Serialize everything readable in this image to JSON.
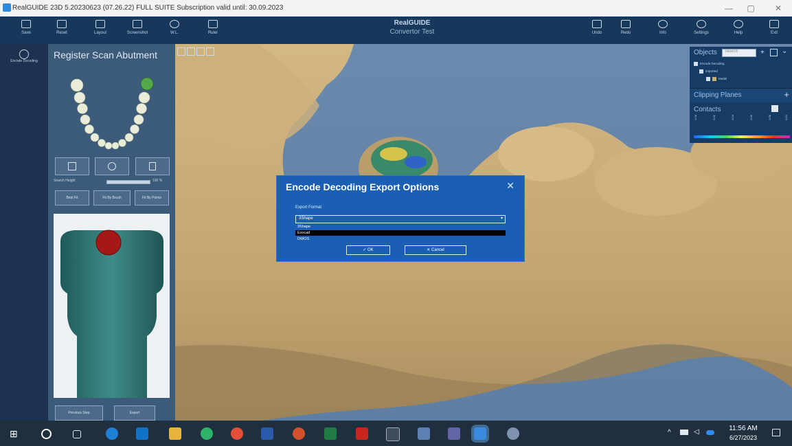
{
  "window": {
    "title": "RealGUIDE 23D 5.20230623 (07.26.22) FULL SUITE Subscription valid until: 30.09.2023"
  },
  "toolbar": {
    "left": [
      "Save",
      "Reset",
      "Layout",
      "Screenshot",
      "W.L.",
      "Ruler"
    ],
    "right": [
      "Undo",
      "Redo",
      "Info",
      "Settings",
      "Help",
      "Exit"
    ],
    "brand_logo": "RealGUIDE",
    "brand_sub": "Convertor Test"
  },
  "rail": {
    "label": "Encode Decoding"
  },
  "panel": {
    "title": "Register Scan Abutment",
    "search_height_label": "Search Height",
    "search_height_value": "100 %",
    "search_height_percent": 100,
    "fit_buttons": [
      "Best Fit",
      "Fit By Brush",
      "Fit By Points"
    ],
    "previous_step": "Previous Step",
    "export": "Export"
  },
  "objects_panel": {
    "title": "Objects",
    "search_placeholder": "Search",
    "tree": [
      "Encode Decoding",
      "Imported",
      "Model"
    ],
    "clipping_planes": "Clipping Planes",
    "contacts": "Contacts",
    "contact_ticks": [
      "0.00",
      "0.02",
      "0.04",
      "0.06",
      "0.08",
      "0.10"
    ]
  },
  "dialog": {
    "title": "Encode Decoding Export Options",
    "close": "✕",
    "export_format_label": "Export Format",
    "selected": "3Shape",
    "options": [
      "3Shape",
      "Exocad",
      "DWOS"
    ],
    "highlighted_option": "Exocad",
    "ok": "OK",
    "cancel": "Cancel"
  },
  "taskbar": {
    "time": "11:56 AM",
    "date": "6/27/2023"
  },
  "colors": {
    "toolbar": "#16385c",
    "panel": "#3c5a7a",
    "dialog": "#1a5fb4",
    "model": "#c9ad78"
  }
}
